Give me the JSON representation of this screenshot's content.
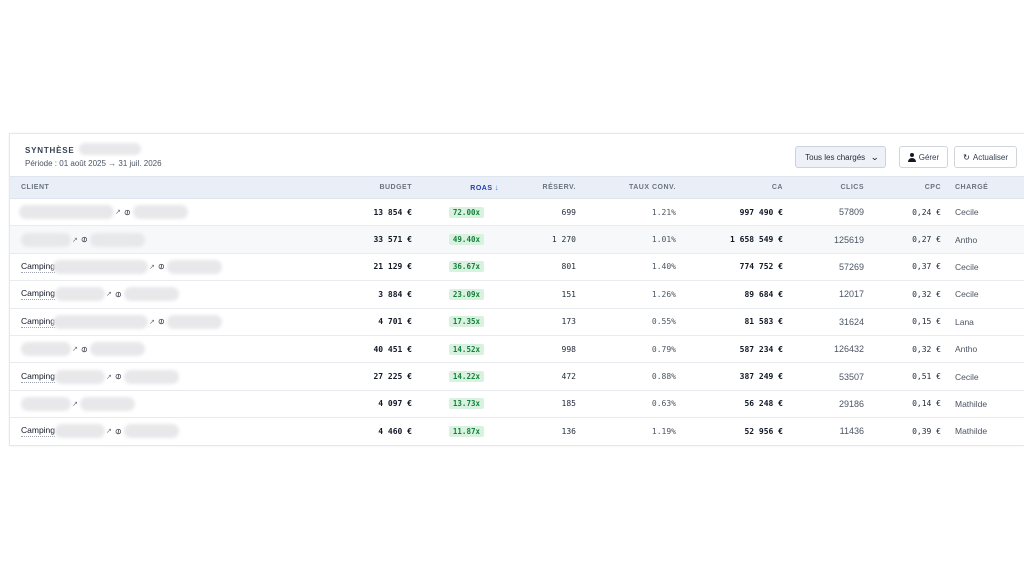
{
  "header": {
    "title": "SYNTHÈSE",
    "period": "Période : 01 août 2025 → 31 juil. 2026"
  },
  "controls": {
    "filter_selected": "Tous les chargés",
    "manage_label": "Gérer",
    "refresh_label": "Actualiser"
  },
  "table": {
    "columns": {
      "client": "CLIENT",
      "budget": "BUDGET",
      "roas": "ROAS",
      "reserv": "RÉSERV.",
      "conv": "TAUX CONV.",
      "ca": "CA",
      "clics": "CLICS",
      "cpc": "CPC",
      "charge": "CHARGÉ"
    },
    "rows": [
      {
        "client": "",
        "budget": "13 854 €",
        "roas": "72.00x",
        "reserv": "699",
        "conv": "1.21%",
        "ca": "997 490 €",
        "clics": "57809",
        "cpc": "0,24 €",
        "charge": "Cecile"
      },
      {
        "client": "",
        "budget": "33 571 €",
        "roas": "49.40x",
        "reserv": "1 270",
        "conv": "1.01%",
        "ca": "1 658 549 €",
        "clics": "125619",
        "cpc": "0,27 €",
        "charge": "Antho"
      },
      {
        "client": "Camping",
        "budget": "21 129 €",
        "roas": "36.67x",
        "reserv": "801",
        "conv": "1.40%",
        "ca": "774 752 €",
        "clics": "57269",
        "cpc": "0,37 €",
        "charge": "Cecile"
      },
      {
        "client": "Camping",
        "budget": "3 884 €",
        "roas": "23.09x",
        "reserv": "151",
        "conv": "1.26%",
        "ca": "89 684 €",
        "clics": "12017",
        "cpc": "0,32 €",
        "charge": "Cecile"
      },
      {
        "client": "Camping",
        "budget": "4 701 €",
        "roas": "17.35x",
        "reserv": "173",
        "conv": "0.55%",
        "ca": "81 583 €",
        "clics": "31624",
        "cpc": "0,15 €",
        "charge": "Lana"
      },
      {
        "client": "",
        "budget": "40 451 €",
        "roas": "14.52x",
        "reserv": "998",
        "conv": "0.79%",
        "ca": "587 234 €",
        "clics": "126432",
        "cpc": "0,32 €",
        "charge": "Antho"
      },
      {
        "client": "Camping",
        "budget": "27 225 €",
        "roas": "14.22x",
        "reserv": "472",
        "conv": "0.88%",
        "ca": "387 249 €",
        "clics": "53507",
        "cpc": "0,51 €",
        "charge": "Cecile"
      },
      {
        "client": "",
        "budget": "4 097 €",
        "roas": "13.73x",
        "reserv": "185",
        "conv": "0.63%",
        "ca": "56 248 €",
        "clics": "29186",
        "cpc": "0,14 €",
        "charge": "Mathilde"
      },
      {
        "client": "Camping",
        "budget": "4 460 €",
        "roas": "11.87x",
        "reserv": "136",
        "conv": "1.19%",
        "ca": "52 956 €",
        "clics": "11436",
        "cpc": "0,39 €",
        "charge": "Mathilde"
      }
    ]
  },
  "colors": {
    "header_bg": "#eaeff7",
    "roas_badge_bg": "#d9f2df",
    "roas_badge_text": "#15803d",
    "sort_arrow": "#3b82f6"
  },
  "icons": {
    "sort": "arrow-down-icon",
    "manage": "user-icon",
    "refresh": "refresh-icon",
    "external": "external-link-icon",
    "link": "link-icon",
    "dropdown": "chevron-down-icon"
  }
}
